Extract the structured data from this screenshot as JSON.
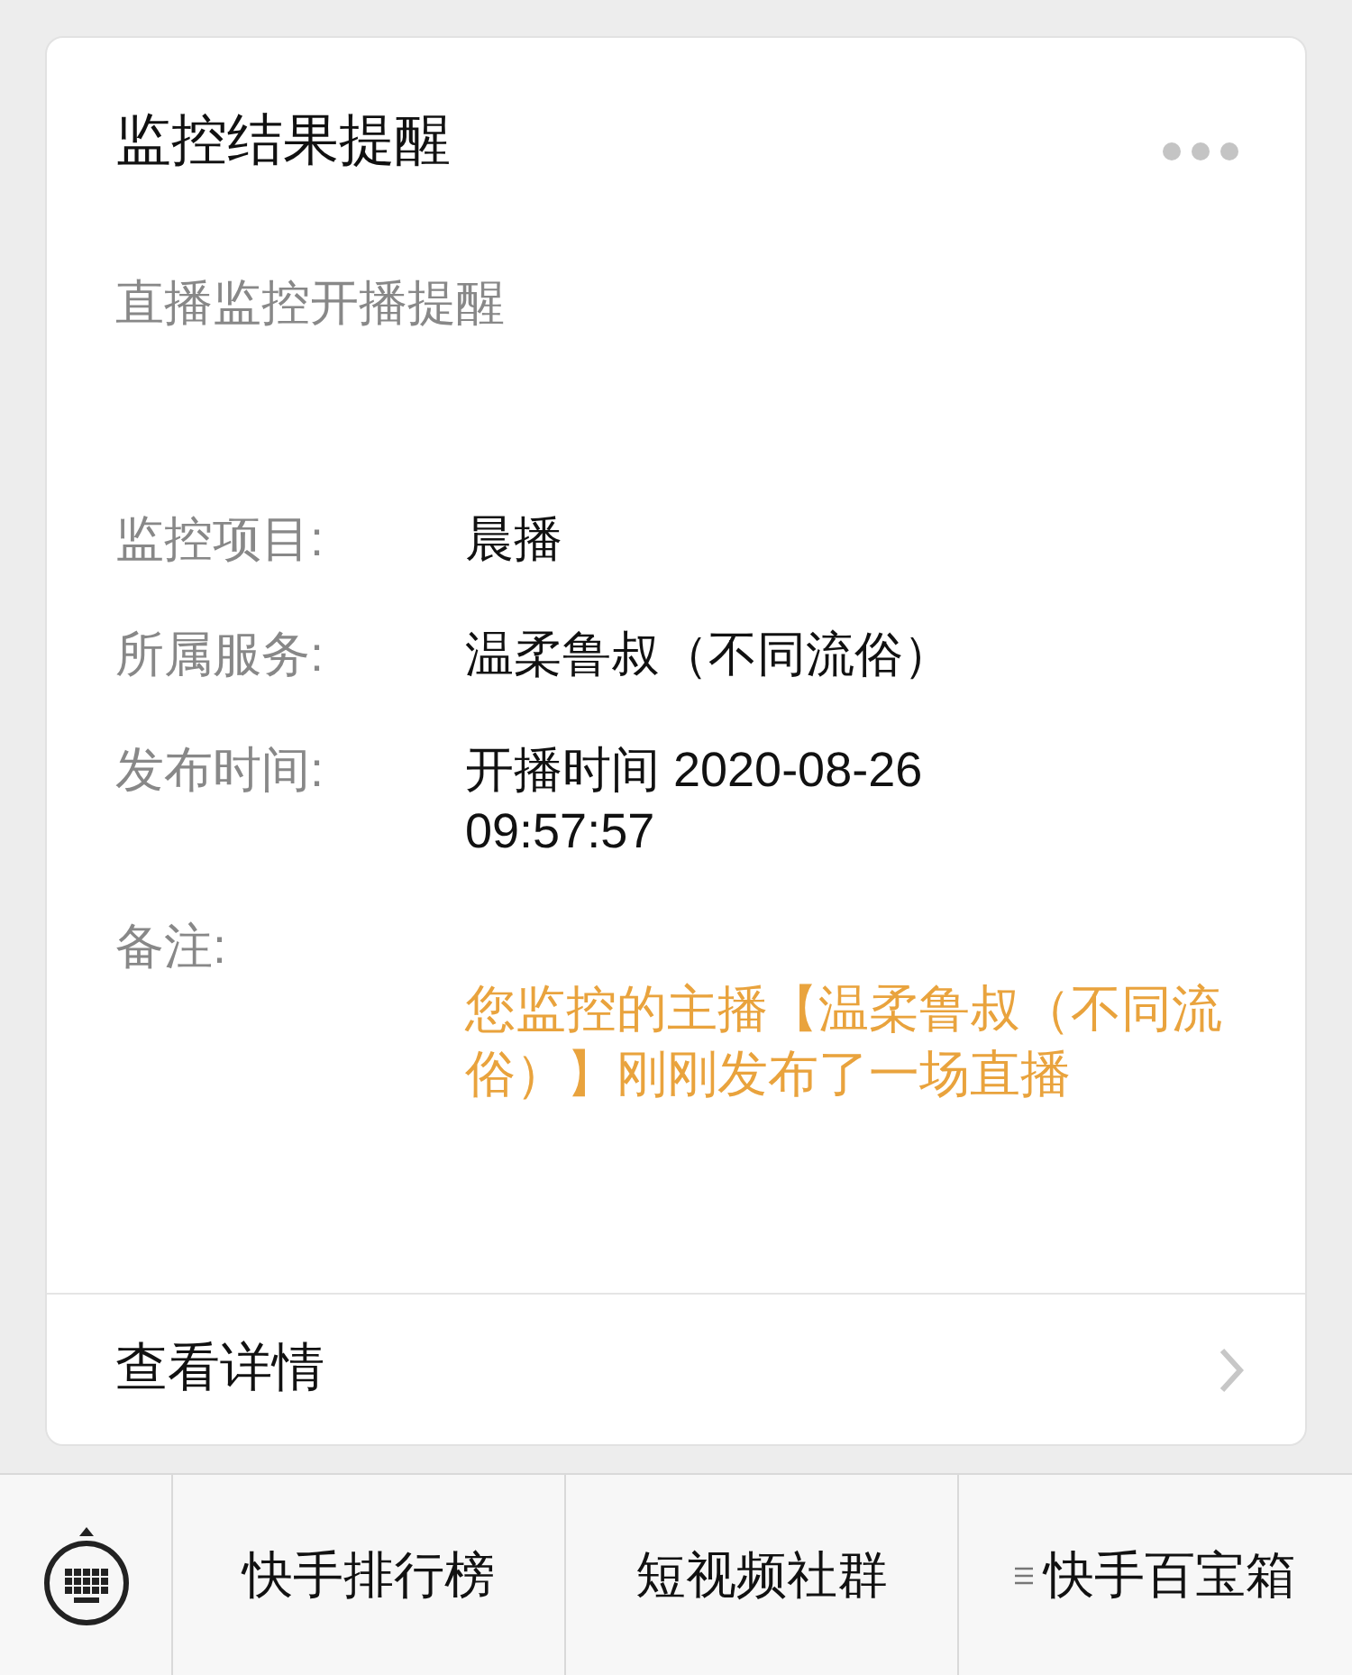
{
  "card": {
    "title": "监控结果提醒",
    "subtitle": "直播监控开播提醒",
    "fields": [
      {
        "label": "监控项目:",
        "value": "晨播"
      },
      {
        "label": "所属服务:",
        "value": "温柔鲁叔（不同流俗）"
      },
      {
        "label": "发布时间:",
        "value": "开播时间 2020-08-26 09:57:57"
      }
    ],
    "note": {
      "label": "备注:",
      "text": "您监控的主播【温柔鲁叔（不同流俗）】刚刚发布了一场直播"
    },
    "detail_link": "查看详情"
  },
  "menu_bar": {
    "items": [
      {
        "label": "快手排行榜",
        "kind": "plain"
      },
      {
        "label": "短视频社群",
        "kind": "plain"
      },
      {
        "label": "快手百宝箱",
        "kind": "submenu"
      }
    ]
  }
}
